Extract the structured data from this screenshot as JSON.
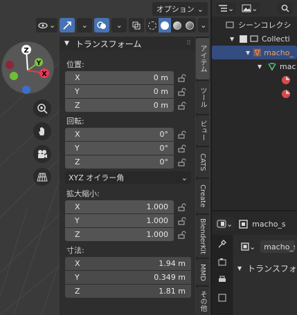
{
  "viewport": {
    "options_label": "オプション",
    "gizmo": {
      "z_label": "Z",
      "y_label": "Y",
      "x_label": "X"
    }
  },
  "transform_panel": {
    "title": "トランスフォーム",
    "location": {
      "label": "位置:",
      "x_label": "X",
      "y_label": "Y",
      "z_label": "Z",
      "x": "0 m",
      "y": "0 m",
      "z": "0 m"
    },
    "rotation": {
      "label": "回転:",
      "x_label": "X",
      "y_label": "Y",
      "z_label": "Z",
      "x": "0°",
      "y": "0°",
      "z": "0°"
    },
    "rotation_mode": "XYZ オイラー角",
    "scale": {
      "label": "拡大縮小:",
      "x_label": "X",
      "y_label": "Y",
      "z_label": "Z",
      "x": "1.000",
      "y": "1.000",
      "z": "1.000"
    },
    "dimensions": {
      "label": "寸法:",
      "x_label": "X",
      "y_label": "Y",
      "z_label": "Z",
      "x": "1.94 m",
      "y": "0.349 m",
      "z": "1.81 m"
    }
  },
  "sidebar_tabs": [
    "アイテム",
    "ツール",
    "ビュー",
    "CATS",
    "Create",
    "BlenderKit",
    "MMD",
    "その他"
  ],
  "outliner": {
    "title": "シーンコレクシ",
    "collection": "Collecti",
    "object": "macho_",
    "child": "mac"
  },
  "properties": {
    "object_name": "macho_s",
    "data_name": "macho_sa",
    "section_title": "トランスフォ"
  },
  "colors": {
    "accent": "#4772b3",
    "selected_row": "#334d80",
    "x_axis": "#e83a56",
    "y_axis": "#80c03b",
    "z_axis": "#3b6fcf",
    "object_orange": "#f0813d"
  }
}
